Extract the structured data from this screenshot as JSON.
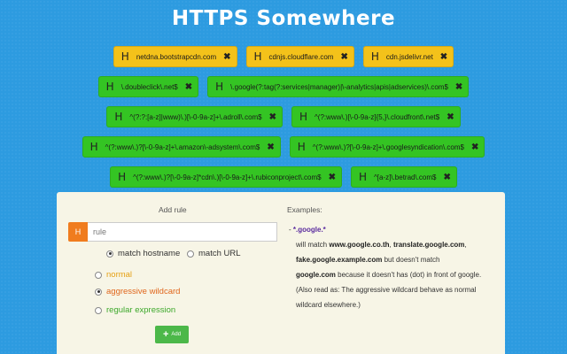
{
  "title": "HTTPS Somewhere",
  "colors": {
    "background": "#2d9be0",
    "yellow_tag": "#f4c21a",
    "green_tag": "#34c423",
    "h_badge": "#f07c1e",
    "add_button": "#4cb849"
  },
  "tags": [
    {
      "h": "H",
      "text": "netdna.bootstrapcdn.com",
      "color": "yellow",
      "close": "✖"
    },
    {
      "h": "H",
      "text": "cdnjs.cloudflare.com",
      "color": "yellow",
      "close": "✖"
    },
    {
      "h": "H",
      "text": "cdn.jsdelivr.net",
      "color": "yellow",
      "close": "✖"
    },
    {
      "h": "H",
      "text": "\\.doubleclick\\.net$",
      "color": "green",
      "close": "✖"
    },
    {
      "h": "H",
      "text": "\\.google(?:tag(?:services|manager)|\\-analytics|apis|adservices)\\.com$",
      "color": "green",
      "close": "✖"
    },
    {
      "h": "H",
      "text": "^(?:?:[a-z]|www)\\.)[\\-0-9a-z]+\\.adroll\\.com$",
      "color": "green",
      "close": "✖"
    },
    {
      "h": "H",
      "text": "^(?:www\\.)[\\-0-9a-z]{5,}\\.cloudfront\\.net$",
      "color": "green",
      "close": "✖"
    },
    {
      "h": "H",
      "text": "^(?:www\\.)?[\\-0-9a-z]+\\.amazon\\-adsystem\\.com$",
      "color": "green",
      "close": "✖"
    },
    {
      "h": "H",
      "text": "^(?:www\\.)?[\\-0-9a-z]+\\.googlesyndication\\.com$",
      "color": "green",
      "close": "✖"
    },
    {
      "h": "H",
      "text": "^(?:www\\.)?[\\-0-9a-z]*cdn\\.)[\\-0-9a-z]+\\.rubiconproject\\.com$",
      "color": "green",
      "close": "✖"
    },
    {
      "h": "H",
      "text": "^[a-z]\\.betrad\\.com$",
      "color": "green",
      "close": "✖"
    }
  ],
  "add_rule": {
    "title": "Add rule",
    "h": "H",
    "placeholder": "rule",
    "match_hostname": "match hostname",
    "match_url": "match URL",
    "normal": "normal",
    "aggressive": "aggressive wildcard",
    "regex": "regular expression",
    "add_label": "Add",
    "plus": "+"
  },
  "examples": {
    "title": "Examples:",
    "bullet": "- ",
    "pattern": "*.google.*",
    "l1a": "will match ",
    "ex1": "www.google.co.th",
    "sep1": ", ",
    "ex2": "translate.google.com",
    "sep2": ",",
    "ex3": "fake.google.example.com",
    "l2b": " but doesn't match",
    "ex4": "google.com",
    "l3b": " because it doesn't has (dot) in front of google.",
    "l4": "(Also read as: The aggressive wildcard behave as normal",
    "l5": "wildcard elsewhere.)"
  }
}
